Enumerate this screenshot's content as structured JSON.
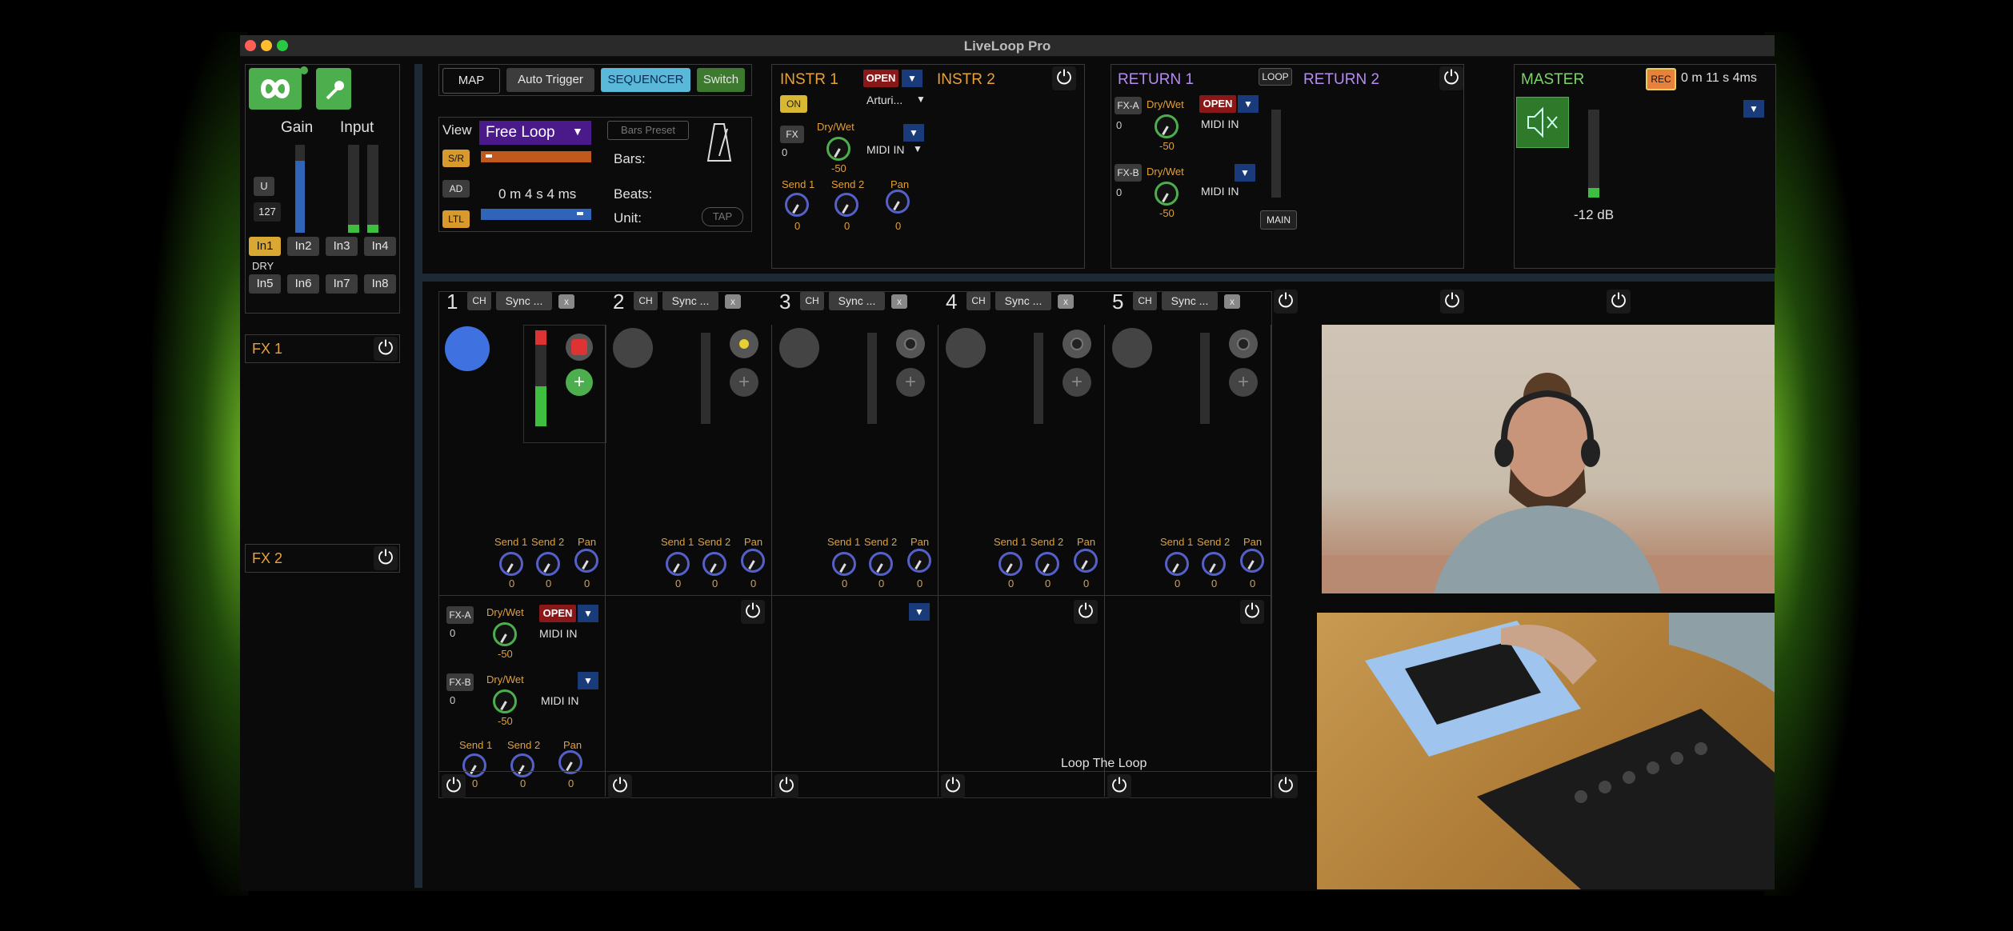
{
  "window": {
    "title": "LiveLoop Pro"
  },
  "input_panel": {
    "gain_label": "Gain",
    "input_label": "Input",
    "u_label": "U",
    "value_127": "127",
    "inputs_row1": [
      "In1",
      "In2",
      "In3",
      "In4"
    ],
    "dry_label": "DRY",
    "inputs_row2": [
      "In5",
      "In6",
      "In7",
      "In8"
    ]
  },
  "fx_slots": [
    {
      "label": "FX 1"
    },
    {
      "label": "FX 2"
    }
  ],
  "toolbar": {
    "map": "MAP",
    "auto_trigger": "Auto Trigger",
    "sequencer": "SEQUENCER",
    "switch": "Switch"
  },
  "loop_controls": {
    "view": "View",
    "sr": "S/R",
    "ad": "AD",
    "ltl": "LTL",
    "mode": "Free Loop",
    "time": "0 m  4  s 4 ms",
    "bars_preset": "Bars Preset",
    "bars": "Bars:",
    "beats": "Beats:",
    "unit": "Unit:",
    "tap": "TAP"
  },
  "instr1": {
    "name": "INSTR 1",
    "open": "OPEN",
    "on": "ON",
    "device": "Arturi...",
    "fx": "FX",
    "fx_val": "0",
    "drywet": "Dry/Wet",
    "drywet_val": "-50",
    "midi_in": "MIDI IN",
    "send1": "Send 1",
    "send2": "Send 2",
    "pan": "Pan",
    "send1_val": "0",
    "send2_val": "0",
    "pan_val": "0"
  },
  "instr2": {
    "name": "INSTR 2"
  },
  "return1": {
    "name": "RETURN 1",
    "loop": "LOOP",
    "fxa": "FX-A",
    "fxa_val": "0",
    "fxb": "FX-B",
    "fxb_val": "0",
    "drywet": "Dry/Wet",
    "drywet_a_val": "-50",
    "drywet_b_val": "-50",
    "open": "OPEN",
    "midi_in": "MIDI IN",
    "main": "MAIN"
  },
  "return2": {
    "name": "RETURN 2"
  },
  "master": {
    "name": "MASTER",
    "rec": "REC",
    "time": "0   m 11 s 4ms",
    "db": "-12 dB"
  },
  "tracks": [
    {
      "num": "1",
      "ch": "CH",
      "sync": "Sync ...",
      "x": "x"
    },
    {
      "num": "2",
      "ch": "CH",
      "sync": "Sync ...",
      "x": "x"
    },
    {
      "num": "3",
      "ch": "CH",
      "sync": "Sync ...",
      "x": "x"
    },
    {
      "num": "4",
      "ch": "CH",
      "sync": "Sync ...",
      "x": "x"
    },
    {
      "num": "5",
      "ch": "CH",
      "sync": "Sync ...",
      "x": "x"
    }
  ],
  "track_knobs": {
    "send1": "Send 1",
    "send2": "Send 2",
    "pan": "Pan",
    "zero": "0"
  },
  "track1_fx": {
    "fxa": "FX-A",
    "fxa_val": "0",
    "fxb": "FX-B",
    "fxb_val": "0",
    "drywet": "Dry/Wet",
    "drywet_val": "-50",
    "open": "OPEN",
    "midi_in": "MIDI IN",
    "send1": "Send 1",
    "send2": "Send 2",
    "pan": "Pan",
    "zero": "0"
  },
  "footer": {
    "loop_the_loop": "Loop The Loop"
  },
  "colors": {
    "accent_green": "#4cae4c",
    "rec_orange": "#e8823a",
    "seq_blue": "#5ab8d8"
  }
}
